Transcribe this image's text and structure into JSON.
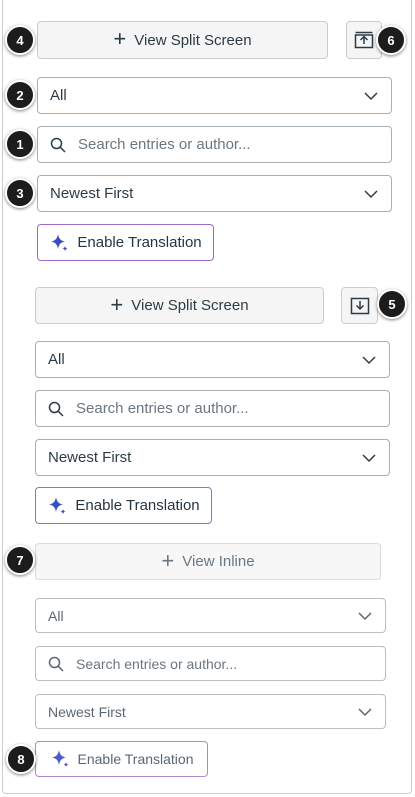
{
  "section1": {
    "split_label": "View Split Screen",
    "filter_value": "All",
    "search_placeholder": "Search entries or author...",
    "sort_value": "Newest First",
    "translate_label": "Enable Translation"
  },
  "section2": {
    "split_label": "View Split Screen",
    "filter_value": "All",
    "search_placeholder": "Search entries or author...",
    "sort_value": "Newest First",
    "translate_label": "Enable Translation"
  },
  "section3": {
    "inline_label": "View Inline",
    "filter_value": "All",
    "search_placeholder": "Search entries or author...",
    "sort_value": "Newest First",
    "translate_label": "Enable Translation"
  },
  "badges": {
    "b1": "1",
    "b2": "2",
    "b3": "3",
    "b4": "4",
    "b5": "5",
    "b6": "6",
    "b7": "7",
    "b8": "8"
  },
  "colors": {
    "accent_purple": "#9c6ac8",
    "sparkle": "#3b4cbf",
    "badge_bg": "#1c1c1c"
  },
  "icons": {
    "plus": "plus-icon",
    "upload": "upload-icon",
    "download": "download-icon",
    "search": "search-icon",
    "chevron": "chevron-down-icon",
    "sparkle": "sparkle-icon"
  }
}
